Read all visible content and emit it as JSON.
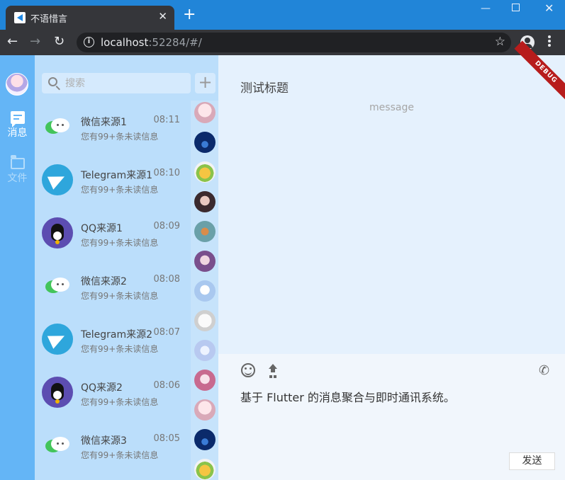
{
  "browser": {
    "tab_title": "不语惜言",
    "url_host": "localhost",
    "url_rest": ":52284/#/"
  },
  "rail": {
    "items": [
      {
        "label": "消息",
        "icon": "chat-icon",
        "active": true
      },
      {
        "label": "文件",
        "icon": "folder-icon",
        "active": false
      }
    ]
  },
  "search": {
    "placeholder": "搜索"
  },
  "chats": [
    {
      "name": "微信来源1",
      "time": "08:11",
      "preview": "您有99+条未读信息",
      "icon": "wechat-icon"
    },
    {
      "name": "Telegram来源1",
      "time": "08:10",
      "preview": "您有99+条未读信息",
      "icon": "telegram-icon"
    },
    {
      "name": "QQ来源1",
      "time": "08:09",
      "preview": "您有99+条未读信息",
      "icon": "qq-icon"
    },
    {
      "name": "微信来源2",
      "time": "08:08",
      "preview": "您有99+条未读信息",
      "icon": "wechat-icon"
    },
    {
      "name": "Telegram来源2",
      "time": "08:07",
      "preview": "您有99+条未读信息",
      "icon": "telegram-icon"
    },
    {
      "name": "QQ来源2",
      "time": "08:06",
      "preview": "您有99+条未读信息",
      "icon": "qq-icon"
    },
    {
      "name": "微信来源3",
      "time": "08:05",
      "preview": "您有99+条未读信息",
      "icon": "wechat-icon"
    }
  ],
  "conversation": {
    "title": "测试标题",
    "message": "message",
    "debug_banner": "DEBUG",
    "draft": "基于 Flutter 的消息聚合与即时通讯系统。",
    "send_label": "发送"
  },
  "colors": {
    "rail": "#64b5f6",
    "list": "#bbdefb",
    "main": "#e5f1fd",
    "browser_frame": "#2185d8"
  }
}
